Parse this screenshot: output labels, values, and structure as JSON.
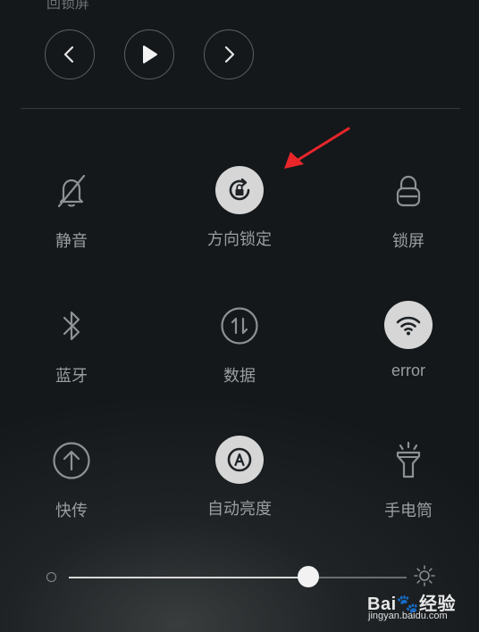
{
  "top_partial_label": "回锁屏",
  "media": {
    "prev_icon": "chevron-left-icon",
    "play_icon": "play-icon",
    "next_icon": "chevron-right-icon"
  },
  "tiles": [
    {
      "label": "静音",
      "icon": "bell-off-icon",
      "active": false
    },
    {
      "label": "方向锁定",
      "icon": "rotation-lock-icon",
      "active": true
    },
    {
      "label": "锁屏",
      "icon": "lock-icon",
      "active": false
    },
    {
      "label": "蓝牙",
      "icon": "bluetooth-icon",
      "active": false
    },
    {
      "label": "数据",
      "icon": "mobile-data-icon",
      "active": false
    },
    {
      "label": "error",
      "icon": "wifi-icon",
      "active": true
    },
    {
      "label": "快传",
      "icon": "upload-circle-icon",
      "active": false
    },
    {
      "label": "自动亮度",
      "icon": "auto-brightness-icon",
      "active": true
    },
    {
      "label": "手电筒",
      "icon": "flashlight-icon",
      "active": false
    }
  ],
  "brightness": {
    "level": 0.71
  },
  "watermark": {
    "logo": "Bai🐾经验",
    "url": "jingyan.baidu.com"
  },
  "colors": {
    "arrow": "#e8262a",
    "active_bg": "#d6d6d6"
  }
}
